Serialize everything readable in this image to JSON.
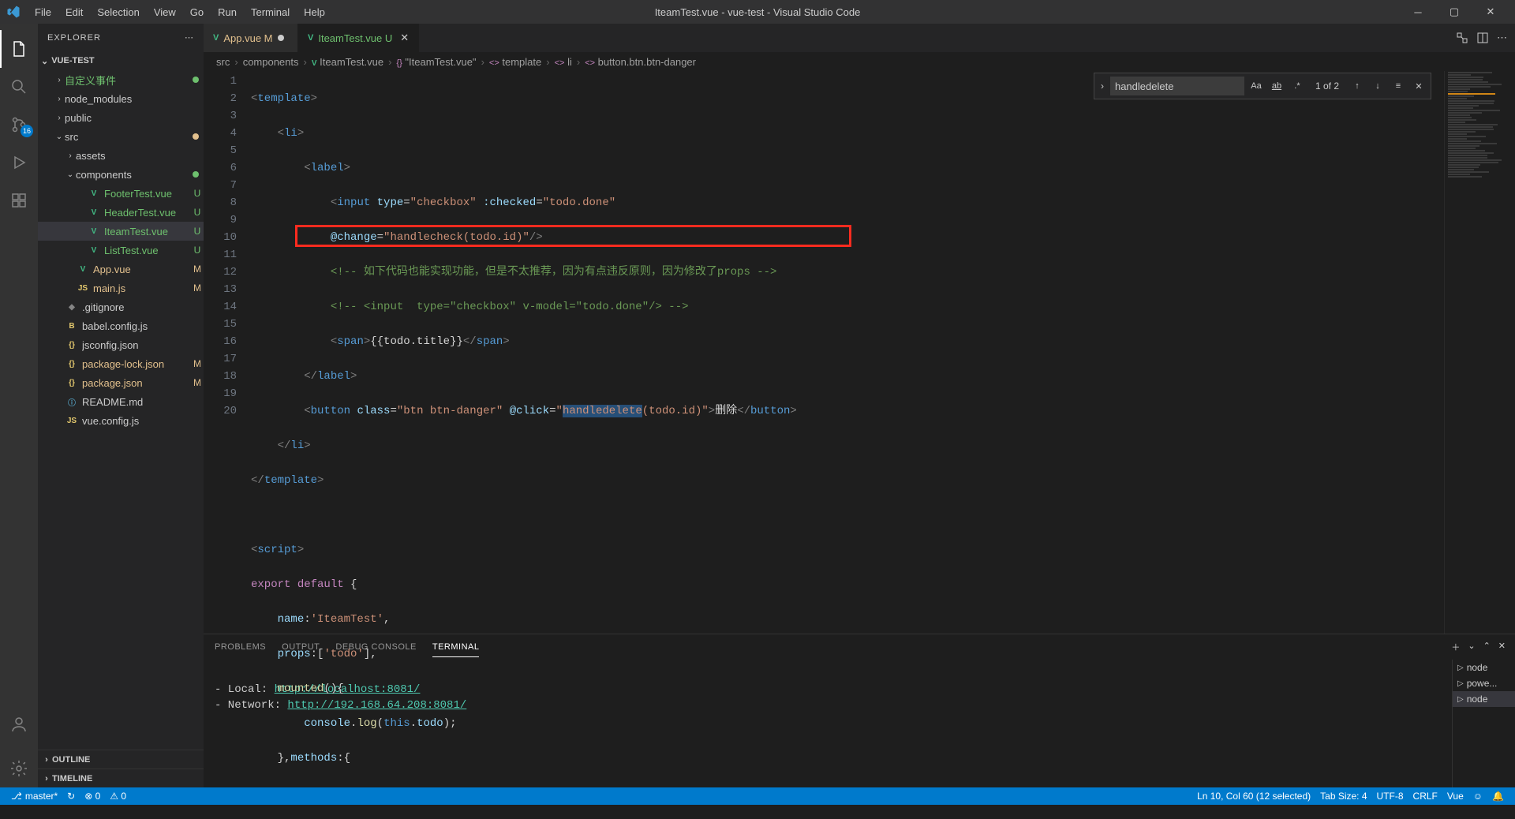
{
  "window": {
    "title": "IteamTest.vue - vue-test - Visual Studio Code"
  },
  "menu": [
    "File",
    "Edit",
    "Selection",
    "View",
    "Go",
    "Run",
    "Terminal",
    "Help"
  ],
  "activity": {
    "scm_badge": "16"
  },
  "sidebar": {
    "title": "EXPLORER",
    "folder": "VUE-TEST",
    "items": [
      {
        "name": "自定义事件",
        "type": "folder",
        "indent": 1,
        "arrow": "›",
        "color": "green-text",
        "dot": "#6ec06e"
      },
      {
        "name": "node_modules",
        "type": "folder",
        "indent": 1,
        "arrow": "›"
      },
      {
        "name": "public",
        "type": "folder",
        "indent": 1,
        "arrow": "›"
      },
      {
        "name": "src",
        "type": "folder",
        "indent": 1,
        "arrow": "⌄",
        "dot": "#e2c08d"
      },
      {
        "name": "assets",
        "type": "folder",
        "indent": 2,
        "arrow": "›"
      },
      {
        "name": "components",
        "type": "folder",
        "indent": 2,
        "arrow": "⌄",
        "dot": "#6ec06e"
      },
      {
        "name": "FooterTest.vue",
        "type": "file",
        "indent": 3,
        "iconCls": "vue-icon",
        "icon": "V",
        "status": "U",
        "color": "green-text"
      },
      {
        "name": "HeaderTest.vue",
        "type": "file",
        "indent": 3,
        "iconCls": "vue-icon",
        "icon": "V",
        "status": "U",
        "color": "green-text"
      },
      {
        "name": "IteamTest.vue",
        "type": "file",
        "indent": 3,
        "iconCls": "vue-icon",
        "icon": "V",
        "status": "U",
        "color": "green-text",
        "selected": true
      },
      {
        "name": "ListTest.vue",
        "type": "file",
        "indent": 3,
        "iconCls": "vue-icon",
        "icon": "V",
        "status": "U",
        "color": "green-text"
      },
      {
        "name": "App.vue",
        "type": "file",
        "indent": 2,
        "iconCls": "vue-icon",
        "icon": "V",
        "status": "M",
        "color": "yellow-text"
      },
      {
        "name": "main.js",
        "type": "file",
        "indent": 2,
        "iconCls": "js-icon",
        "icon": "JS",
        "status": "M",
        "color": "yellow-text"
      },
      {
        "name": ".gitignore",
        "type": "file",
        "indent": 1,
        "iconCls": "gray-icon",
        "icon": "◆"
      },
      {
        "name": "babel.config.js",
        "type": "file",
        "indent": 1,
        "iconCls": "js-icon",
        "icon": "B"
      },
      {
        "name": "jsconfig.json",
        "type": "file",
        "indent": 1,
        "iconCls": "json-icon",
        "icon": "{}"
      },
      {
        "name": "package-lock.json",
        "type": "file",
        "indent": 1,
        "iconCls": "json-icon",
        "icon": "{}",
        "status": "M",
        "color": "yellow-text"
      },
      {
        "name": "package.json",
        "type": "file",
        "indent": 1,
        "iconCls": "json-icon",
        "icon": "{}",
        "status": "M",
        "color": "yellow-text"
      },
      {
        "name": "README.md",
        "type": "file",
        "indent": 1,
        "iconCls": "info-icon",
        "icon": "ⓘ"
      },
      {
        "name": "vue.config.js",
        "type": "file",
        "indent": 1,
        "iconCls": "js-icon",
        "icon": "JS"
      }
    ],
    "outline": "OUTLINE",
    "timeline": "TIMELINE"
  },
  "tabs": [
    {
      "label": "App.vue",
      "icon": "V",
      "suffix": "M",
      "active": false
    },
    {
      "label": "IteamTest.vue",
      "icon": "V",
      "suffix": "U",
      "active": true,
      "close": true
    }
  ],
  "breadcrumb": [
    "src",
    "components",
    "IteamTest.vue",
    "\"IteamTest.vue\"",
    "template",
    "li",
    "button.btn.btn-danger"
  ],
  "search": {
    "value": "handledelete",
    "count": "1 of 2"
  },
  "code_lines": [
    "1",
    "2",
    "3",
    "4",
    "5",
    "6",
    "7",
    "8",
    "9",
    "10",
    "11",
    "12",
    "13",
    "14",
    "15",
    "16",
    "17",
    "18",
    "19",
    "20"
  ],
  "panel": {
    "tabs": [
      "PROBLEMS",
      "OUTPUT",
      "DEBUG CONSOLE",
      "TERMINAL"
    ],
    "active": "TERMINAL",
    "lines": [
      {
        "pre": "  - Local:   ",
        "url": "http://localhost:8081/"
      },
      {
        "pre": "  - Network: ",
        "url": "http://192.168.64.208:8081/"
      }
    ],
    "terminals": [
      "node",
      "powe...",
      "node"
    ]
  },
  "statusbar": {
    "branch": "master*",
    "sync": "↻",
    "errors": "⊗ 0",
    "warnings": "⚠ 0",
    "position": "Ln 10, Col 60 (12 selected)",
    "spaces": "Tab Size: 4",
    "encoding": "UTF-8",
    "eol": "CRLF",
    "lang": "Vue",
    "feedback": "☺"
  }
}
